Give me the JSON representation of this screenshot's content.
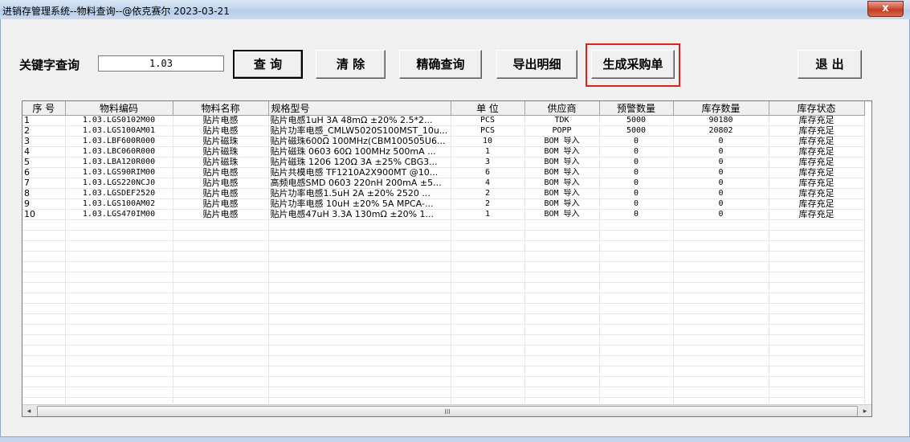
{
  "window": {
    "title": "进销存管理系统--物料查询--@依克赛尔 2023-03-21",
    "close_symbol": "x"
  },
  "search": {
    "label": "关键字查询",
    "value": "1.03"
  },
  "buttons": {
    "query": "查 询",
    "clear": "清 除",
    "exact_query": "精确查询",
    "export_detail": "导出明细",
    "generate_po": "生成采购单",
    "exit": "退 出"
  },
  "table": {
    "columns": [
      "序 号",
      "物料编码",
      "物料名称",
      "规格型号",
      "单 位",
      "供应商",
      "预警数量",
      "库存数量",
      "库存状态"
    ],
    "rows": [
      [
        "1",
        "1.03.LGS0102M00",
        "贴片电感",
        "贴片电感1uH 3A 48mΩ ±20% 2.5*2...",
        "PCS",
        "TDK",
        "5000",
        "90180",
        "库存充足"
      ],
      [
        "2",
        "1.03.LGS100AM01",
        "贴片电感",
        "贴片功率电感_CMLW5020S100MST_10u...",
        "PCS",
        "POPP",
        "5000",
        "20802",
        "库存充足"
      ],
      [
        "3",
        "1.03.LBF600R000",
        "贴片磁珠",
        "贴片磁珠600Ω 100MHz(CBM100505U6...",
        "10",
        "BOM 导入",
        "0",
        "0",
        "库存充足"
      ],
      [
        "4",
        "1.03.LBC060R000",
        "贴片磁珠",
        "贴片磁珠 0603 60Ω 100MHz 500mA ...",
        "1",
        "BOM 导入",
        "0",
        "0",
        "库存充足"
      ],
      [
        "5",
        "1.03.LBA120R000",
        "贴片磁珠",
        "贴片磁珠 1206 120Ω 3A ±25% CBG3...",
        "3",
        "BOM 导入",
        "0",
        "0",
        "库存充足"
      ],
      [
        "6",
        "1.03.LGS90RIM00",
        "贴片电感",
        "贴片共模电感 TF1210A2X900MT @10...",
        "6",
        "BOM 导入",
        "0",
        "0",
        "库存充足"
      ],
      [
        "7",
        "1.03.LGS220NCJ0",
        "贴片电感",
        "高频电感SMD 0603 220nH 200mA ±5...",
        "4",
        "BOM 导入",
        "0",
        "0",
        "库存充足"
      ],
      [
        "8",
        "1.03.LGSDEF2520",
        "贴片电感",
        "贴片功率电感1.5uH 2A ±20% 2520 ...",
        "2",
        "BOM 导入",
        "0",
        "0",
        "库存充足"
      ],
      [
        "9",
        "1.03.LGS100AM02",
        "贴片电感",
        "贴片功率电感 10uH ±20% 5A MPCA-...",
        "2",
        "BOM 导入",
        "0",
        "0",
        "库存充足"
      ],
      [
        "10",
        "1.03.LGS470IM00",
        "贴片电感",
        "贴片电感47uH 3.3A 130mΩ ±20% 1...",
        "1",
        "BOM 导入",
        "0",
        "0",
        "库存充足"
      ]
    ]
  },
  "scrollbar": {
    "left_arrow": "◂",
    "right_arrow": "▸",
    "thumb_grip": "III"
  }
}
